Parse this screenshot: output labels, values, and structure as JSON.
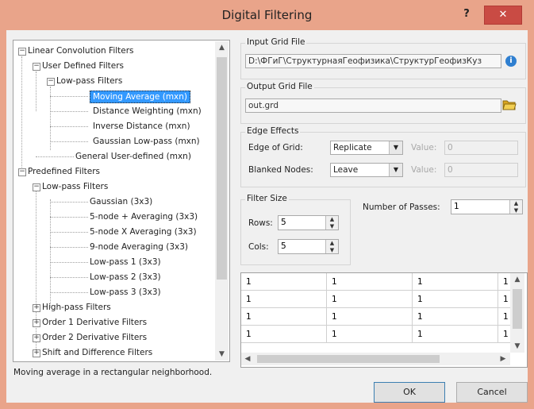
{
  "window": {
    "title": "Digital Filtering",
    "help_label": "?",
    "close_label": "✕"
  },
  "tree": {
    "items": [
      {
        "label": "Linear Convolution Filters",
        "expander": "−"
      },
      {
        "label": "User Defined Filters",
        "expander": "−"
      },
      {
        "label": "Low-pass Filters",
        "expander": "−"
      },
      {
        "label": "Moving Average (mxn)",
        "selected": true
      },
      {
        "label": "Distance Weighting (mxn)"
      },
      {
        "label": "Inverse Distance (mxn)"
      },
      {
        "label": "Gaussian Low-pass (mxn)"
      },
      {
        "label": "General User-defined (mxn)"
      },
      {
        "label": "Predefined Filters",
        "expander": "−"
      },
      {
        "label": "Low-pass Filters",
        "expander": "−"
      },
      {
        "label": "Gaussian (3x3)"
      },
      {
        "label": "5-node + Averaging (3x3)"
      },
      {
        "label": "5-node X Averaging (3x3)"
      },
      {
        "label": "9-node Averaging (3x3)"
      },
      {
        "label": "Low-pass 1 (3x3)"
      },
      {
        "label": "Low-pass 2 (3x3)"
      },
      {
        "label": "Low-pass 3 (3x3)"
      },
      {
        "label": "High-pass Filters",
        "expander": "+"
      },
      {
        "label": "Order 1 Derivative Filters",
        "expander": "+"
      },
      {
        "label": "Order 2 Derivative Filters",
        "expander": "+"
      },
      {
        "label": "Shift and Difference Filters",
        "expander": "+"
      }
    ],
    "description": "Moving average in a rectangular neighborhood."
  },
  "input_grid": {
    "label": "Input Grid File",
    "value": "D:\\ФГиГ\\СтруктурнаяГеофизика\\СтруктурГеофизКуз"
  },
  "output_grid": {
    "label": "Output Grid File",
    "value": "out.grd"
  },
  "edge_effects": {
    "label": "Edge Effects",
    "edge_of_grid_label": "Edge of Grid:",
    "edge_of_grid_value": "Replicate",
    "blanked_nodes_label": "Blanked Nodes:",
    "blanked_nodes_value": "Leave",
    "value_label": "Value:",
    "value1": "0",
    "value2": "0"
  },
  "filter_size": {
    "label": "Filter Size",
    "rows_label": "Rows:",
    "rows_value": "5",
    "cols_label": "Cols:",
    "cols_value": "5"
  },
  "passes": {
    "label": "Number of Passes:",
    "value": "1"
  },
  "grid_rows": [
    [
      "1",
      "1",
      "1",
      "1"
    ],
    [
      "1",
      "1",
      "1",
      "1"
    ],
    [
      "1",
      "1",
      "1",
      "1"
    ],
    [
      "1",
      "1",
      "1",
      "1"
    ]
  ],
  "buttons": {
    "ok": "OK",
    "cancel": "Cancel"
  },
  "colors": {
    "title_bar": "#e9a48a",
    "selection": "#3399ff",
    "close": "#c94b44"
  }
}
